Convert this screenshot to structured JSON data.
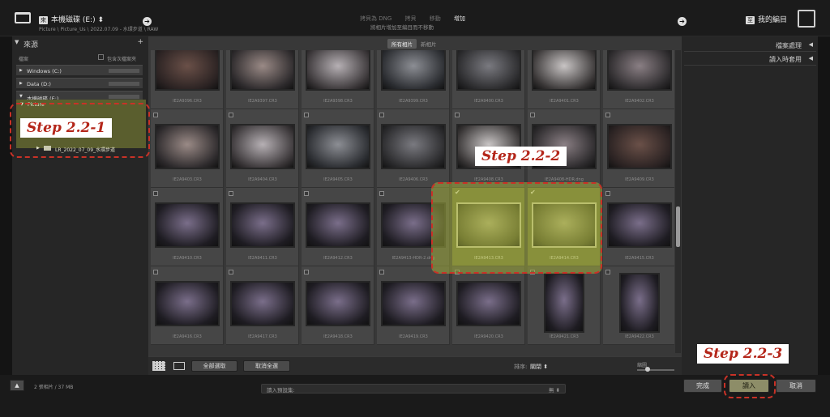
{
  "header": {
    "source_badge": "來",
    "source_title": "本機磁碟 (E:)",
    "source_path": "Picture \\ Picture_Us \\ 2022.07.09 - 水環步道 \\ RAW",
    "modes": [
      "拷貝為 DNG",
      "拷貝",
      "移動",
      "增加"
    ],
    "active_mode": "增加",
    "mode_description": "將相片增加至編目而不移動",
    "dest_badge": "至",
    "dest_title": "我的編目"
  },
  "left": {
    "title": "來源",
    "add_icon": "plus-icon",
    "files_label": "檔案",
    "subfolders_label": "包含次檔案夾",
    "volumes": [
      {
        "label": "Windows (C:)"
      },
      {
        "label": "Data (D:)"
      },
      {
        "label": "本機磁碟 (E:)"
      }
    ],
    "folder_picture": "Picture",
    "folder_selected": "LR_2022_07_09_水環步道"
  },
  "grid": {
    "tab_all": "所有相片",
    "tab_new": "新相片",
    "rows": [
      [
        {
          "name": "IE2A9396.CR3",
          "sel": false
        },
        {
          "name": "IE2A9397.CR3",
          "sel": false
        },
        {
          "name": "IE2A9398.CR3",
          "sel": false
        },
        {
          "name": "IE2A9399.CR3",
          "sel": false
        },
        {
          "name": "IE2A9400.CR3",
          "sel": false
        },
        {
          "name": "IE2A9401.CR3",
          "sel": false
        },
        {
          "name": "IE2A9402.CR3",
          "sel": false
        }
      ],
      [
        {
          "name": "IE2A9403.CR3",
          "sel": false
        },
        {
          "name": "IE2A9404.CR3",
          "sel": false
        },
        {
          "name": "IE2A9405.CR3",
          "sel": false
        },
        {
          "name": "IE2A9406.CR3",
          "sel": false
        },
        {
          "name": "IE2A9408.CR3",
          "sel": false
        },
        {
          "name": "IE2A9408-HDR.dng",
          "sel": false
        },
        {
          "name": "IE2A9409.CR3",
          "sel": false
        }
      ],
      [
        {
          "name": "IE2A9410.CR3",
          "sel": false
        },
        {
          "name": "IE2A9411.CR3",
          "sel": false
        },
        {
          "name": "IE2A9412.CR3",
          "sel": false
        },
        {
          "name": "IE2A9413-HDR-2.dng",
          "sel": false
        },
        {
          "name": "IE2A9413.CR3",
          "sel": true
        },
        {
          "name": "IE2A9414.CR3",
          "sel": true
        },
        {
          "name": "IE2A9415.CR3",
          "sel": false
        }
      ],
      [
        {
          "name": "IE2A9416.CR3",
          "sel": false
        },
        {
          "name": "IE2A9417.CR3",
          "sel": false
        },
        {
          "name": "IE2A9418.CR3",
          "sel": false
        },
        {
          "name": "IE2A9419.CR3",
          "sel": false
        },
        {
          "name": "IE2A9420.CR3",
          "sel": false
        },
        {
          "name": "IE2A9421.CR3",
          "sel": false
        },
        {
          "name": "IE2A9422.CR3",
          "sel": false
        }
      ]
    ],
    "check_all": "全部選取",
    "uncheck_all": "取消全選",
    "sort_label": "排序:",
    "sort_value": "關閉",
    "thumb_label": "縮圖"
  },
  "right": {
    "file_handling": "檔案處理",
    "apply_during_import": "讀入時套用"
  },
  "bottom": {
    "photo_count": "2 張相片 / 37 MB",
    "preset_label": "讀入預設集:",
    "preset_value": "無",
    "done": "完成",
    "import": "讀入",
    "cancel": "取消"
  },
  "annotations": {
    "step1": "Step 2.2-1",
    "step2": "Step 2.2-2",
    "step3": "Step 2.2-3"
  },
  "colors": {
    "selection": "#6a6f3a",
    "callout_border": "#c93227",
    "callout_text": "#b4261a"
  }
}
